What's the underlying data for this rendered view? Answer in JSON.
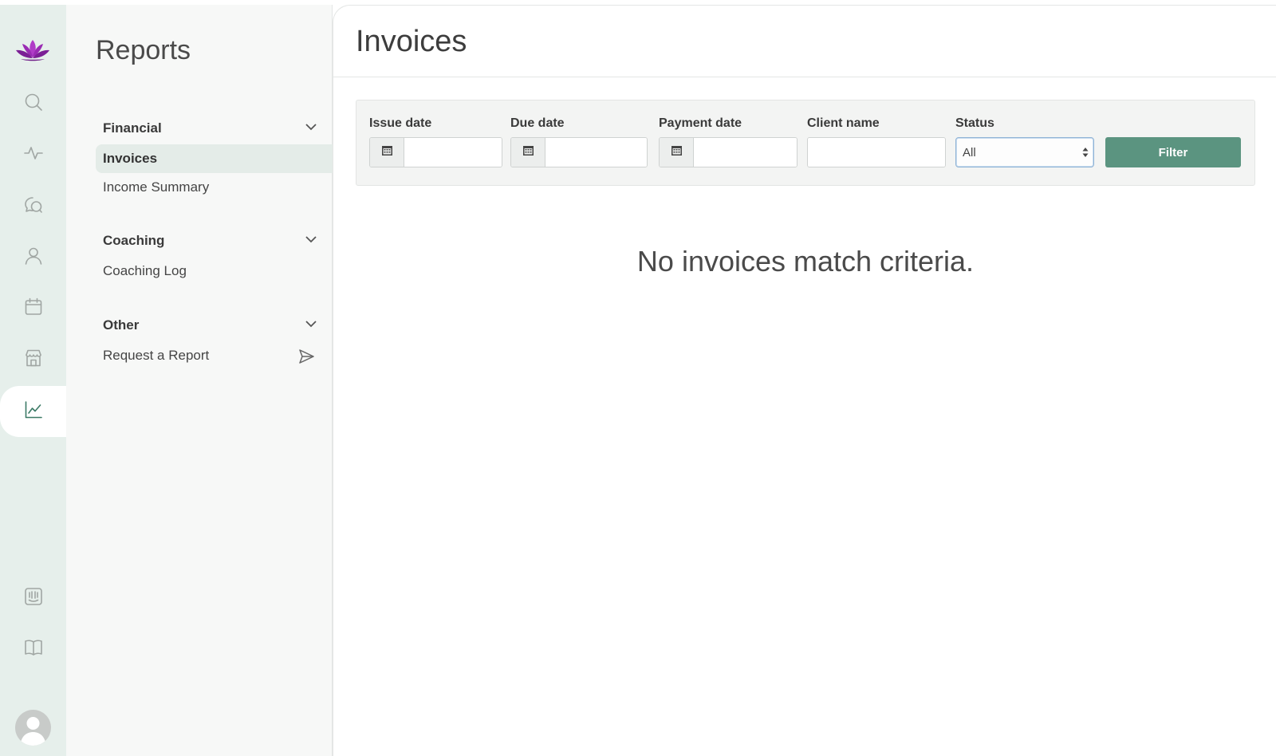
{
  "rail": {
    "items": [
      {
        "name": "search-icon"
      },
      {
        "name": "activity-icon"
      },
      {
        "name": "chat-icon"
      },
      {
        "name": "user-icon"
      },
      {
        "name": "calendar-icon"
      },
      {
        "name": "store-icon"
      },
      {
        "name": "chart-icon",
        "active": true
      }
    ],
    "bottom_items": [
      {
        "name": "intercom-icon"
      },
      {
        "name": "book-icon"
      }
    ],
    "accent_color": "#3c7a66",
    "logo_color": "#9b2bb5"
  },
  "subnav": {
    "title": "Reports",
    "sections": [
      {
        "label": "Financial",
        "links": [
          "Invoices",
          "Income Summary"
        ]
      },
      {
        "label": "Coaching",
        "links": [
          "Coaching Log"
        ]
      },
      {
        "label": "Other",
        "links": [
          "Request a Report"
        ]
      }
    ],
    "active_link": "Invoices"
  },
  "main": {
    "title": "Invoices",
    "filters": {
      "issue_date": {
        "label": "Issue date",
        "value": ""
      },
      "due_date": {
        "label": "Due date",
        "value": ""
      },
      "payment_date": {
        "label": "Payment date",
        "value": ""
      },
      "client_name": {
        "label": "Client name",
        "value": ""
      },
      "status": {
        "label": "Status",
        "value": "All"
      },
      "filter_button": "Filter",
      "button_color": "#5b9480"
    },
    "empty_message": "No invoices match criteria."
  }
}
